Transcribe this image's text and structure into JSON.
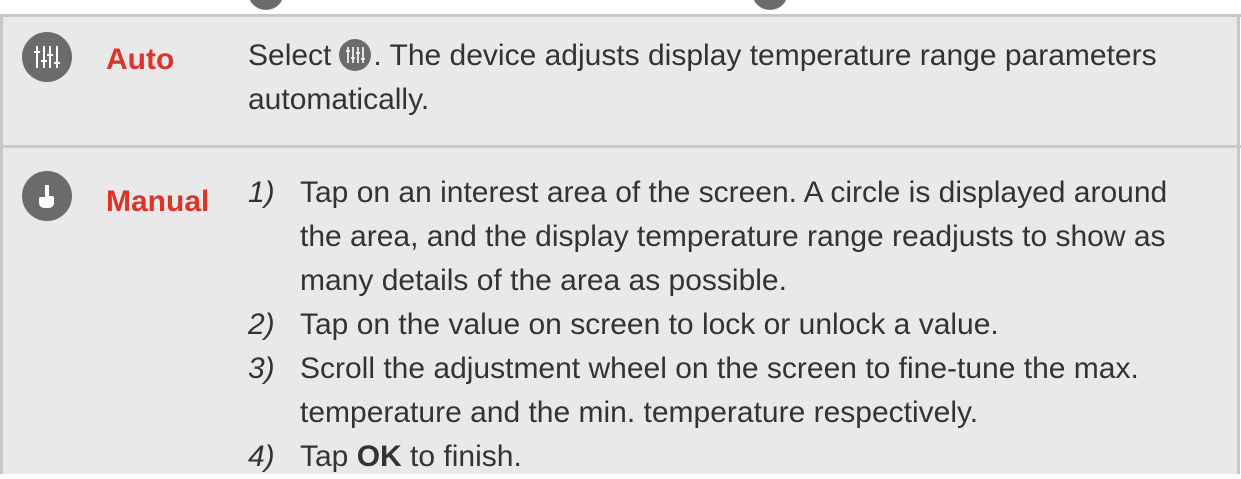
{
  "auto_row": {
    "label": "Auto",
    "text_before_icon": "Select",
    "text_after_icon": ". The device adjusts display temperature range parameters automatically.",
    "icon": "sliders-icon"
  },
  "manual_row": {
    "label": "Manual",
    "icon": "hand-pointer-icon",
    "steps": [
      {
        "num": "1)",
        "text": "Tap on an interest area of the screen. A circle is displayed around the area, and the display temperature range readjusts to show as many details of the area as possible."
      },
      {
        "num": "2)",
        "text": "Tap on the value on screen to lock or unlock a value."
      },
      {
        "num": "3)",
        "text": "Scroll the adjustment wheel on the screen to fine-tune the max. temperature and the min. temperature respectively."
      },
      {
        "num": "4)",
        "text_before": "Tap ",
        "bold": "OK",
        "text_after": " to finish."
      }
    ]
  },
  "colors": {
    "label_red": "#d9352a",
    "row_bg": "#e9e9e9",
    "icon_gray": "#6b6b6b",
    "border": "#c8c8c8"
  }
}
